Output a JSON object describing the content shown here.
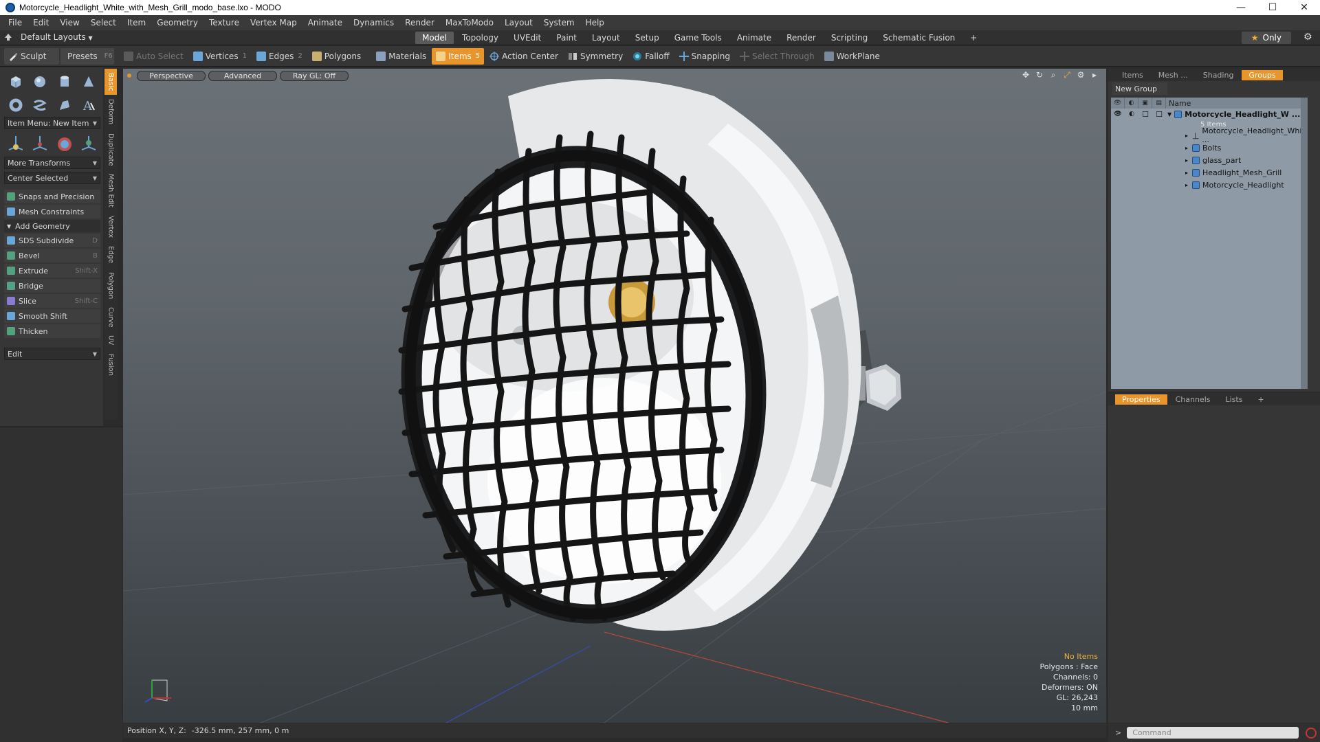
{
  "window": {
    "title": "Motorcycle_Headlight_White_with_Mesh_Grill_modo_base.lxo - MODO",
    "controls": [
      "—",
      "☐",
      "✕"
    ]
  },
  "menu": [
    "File",
    "Edit",
    "View",
    "Select",
    "Item",
    "Geometry",
    "Texture",
    "Vertex Map",
    "Animate",
    "Dynamics",
    "Render",
    "MaxToModo",
    "Layout",
    "System",
    "Help"
  ],
  "layout_bar": {
    "layouts_label": "Default Layouts",
    "tabs": [
      "Model",
      "Topology",
      "UVEdit",
      "Paint",
      "Layout",
      "Setup",
      "Game Tools",
      "Animate",
      "Render",
      "Scripting",
      "Schematic Fusion"
    ],
    "active_tab": "Model",
    "plus": "+",
    "only_label": "Only"
  },
  "toolbar": {
    "sculpt": "Sculpt",
    "presets": "Presets",
    "presets_key": "F6",
    "auto_select": "Auto Select",
    "vertices": "Vertices",
    "vertices_num": "1",
    "edges": "Edges",
    "edges_num": "2",
    "polygons": "Polygons",
    "materials": "Materials",
    "items": "Items",
    "items_num": "5",
    "action_center": "Action Center",
    "symmetry": "Symmetry",
    "falloff": "Falloff",
    "snapping": "Snapping",
    "select_through": "Select Through",
    "workplane": "WorkPlane"
  },
  "left_panel": {
    "item_menu": "Item Menu: New Item",
    "more_transforms": "More Transforms",
    "center_selected": "Center Selected",
    "snaps": "Snaps and Precision",
    "mesh_constraints": "Mesh Constraints",
    "add_geometry": "Add Geometry",
    "tools": [
      {
        "label": "SDS Subdivide",
        "key": "D",
        "color": "#6aa6d8"
      },
      {
        "label": "Bevel",
        "key": "B",
        "color": "#55a080"
      },
      {
        "label": "Extrude",
        "key": "Shift-X",
        "color": "#55a080"
      },
      {
        "label": "Bridge",
        "key": "",
        "color": "#55a080"
      },
      {
        "label": "Slice",
        "key": "Shift-C",
        "color": "#8a7ad0"
      },
      {
        "label": "Smooth Shift",
        "key": "",
        "color": "#6aa6d8"
      },
      {
        "label": "Thicken",
        "key": "",
        "color": "#55a080"
      }
    ],
    "edit": "Edit",
    "vertical_tabs": [
      "Basic",
      "Deform",
      "Duplicate",
      "Mesh Edit",
      "Vertex",
      "Edge",
      "Polygon",
      "Curve",
      "UV",
      "Fusion"
    ]
  },
  "viewport": {
    "buttons": [
      "Perspective",
      "Advanced",
      "Ray GL: Off"
    ],
    "hud": {
      "no_items": "No Items",
      "polygons": "Polygons : Face",
      "channels": "Channels: 0",
      "deformers": "Deformers: ON",
      "gl": "GL: 26,243",
      "scale": "10 mm"
    }
  },
  "status": {
    "label": "Position X, Y, Z:",
    "value": "-326.5 mm, 257 mm, 0 m"
  },
  "right_panel": {
    "tabs": [
      "Items",
      "Mesh ...",
      "Shading",
      "Groups"
    ],
    "active_tab": "Groups",
    "new_group": "New Group",
    "name_header": "Name",
    "group_name": "Motorcycle_Headlight_W ...",
    "group_count": "5 Items",
    "items": [
      "Motorcycle_Headlight_Whit ...",
      "Bolts",
      "glass_part",
      "Headlight_Mesh_Grill",
      "Motorcycle_Headlight"
    ]
  },
  "properties_panel": {
    "tabs": [
      "Properties",
      "Channels",
      "Lists"
    ],
    "active_tab": "Properties",
    "plus": "+"
  },
  "command": {
    "placeholder": "Command",
    "prompt": ">"
  }
}
